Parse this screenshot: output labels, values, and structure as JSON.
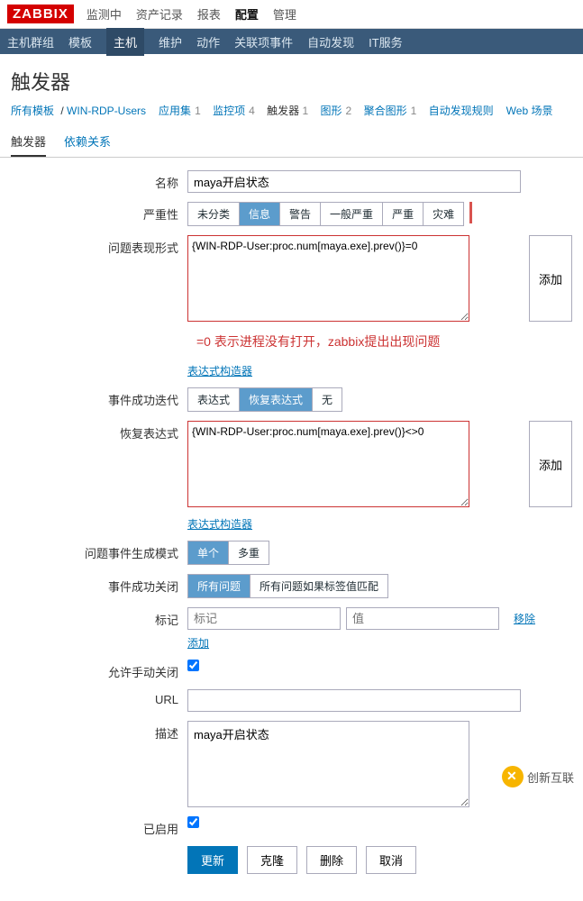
{
  "logo": "ZABBIX",
  "topnav": {
    "items": [
      "监测中",
      "资产记录",
      "报表",
      "配置",
      "管理"
    ],
    "active": 3
  },
  "subnav": {
    "items": [
      "主机群组",
      "模板",
      "主机",
      "维护",
      "动作",
      "关联项事件",
      "自动发现",
      "IT服务"
    ],
    "active": 2
  },
  "page_title": "触发器",
  "crumbs": {
    "all_templates": "所有模板",
    "host": "WIN-RDP-Users",
    "items": [
      {
        "label": "应用集",
        "count": "1"
      },
      {
        "label": "监控项",
        "count": "4"
      },
      {
        "label": "触发器",
        "count": "1",
        "current": true
      },
      {
        "label": "图形",
        "count": "2"
      },
      {
        "label": "聚合图形",
        "count": "1"
      },
      {
        "label": "自动发现规则",
        "count": ""
      },
      {
        "label": "Web 场景",
        "count": ""
      }
    ]
  },
  "tabs": {
    "items": [
      "触发器",
      "依赖关系"
    ],
    "active": 0
  },
  "form": {
    "name_label": "名称",
    "name_value": "maya开启状态",
    "severity_label": "严重性",
    "severity_opts": [
      "未分类",
      "信息",
      "警告",
      "一般严重",
      "严重",
      "灾难"
    ],
    "severity_sel": 1,
    "expr_label": "问题表现形式",
    "expr_value": "{WIN-RDP-User:proc.num[maya.exe].prev()}=0",
    "add_btn": "添加",
    "red_note": "=0    表示进程没有打开，zabbix提出出现问题",
    "builder": "表达式构造器",
    "gen_label": "事件成功迭代",
    "gen_opts": [
      "表达式",
      "恢复表达式",
      "无"
    ],
    "gen_sel": 1,
    "rec_label": "恢复表达式",
    "rec_value": "{WIN-RDP-User:proc.num[maya.exe].prev()}<>0",
    "mode_label": "问题事件生成模式",
    "mode_opts": [
      "单个",
      "多重"
    ],
    "mode_sel": 0,
    "close_label": "事件成功关闭",
    "close_opts": [
      "所有问题",
      "所有问题如果标签值匹配"
    ],
    "close_sel": 0,
    "tag_label": "标记",
    "tag_ph": "标记",
    "val_ph": "值",
    "remove": "移除",
    "add_link": "添加",
    "allow_label": "允许手动关闭",
    "url_label": "URL",
    "url_value": "",
    "desc_label": "描述",
    "desc_value": "maya开启状态",
    "enabled_label": "已启用",
    "btns": {
      "update": "更新",
      "clone": "克隆",
      "delete": "删除",
      "cancel": "取消"
    }
  },
  "footer_brand": "创新互联"
}
